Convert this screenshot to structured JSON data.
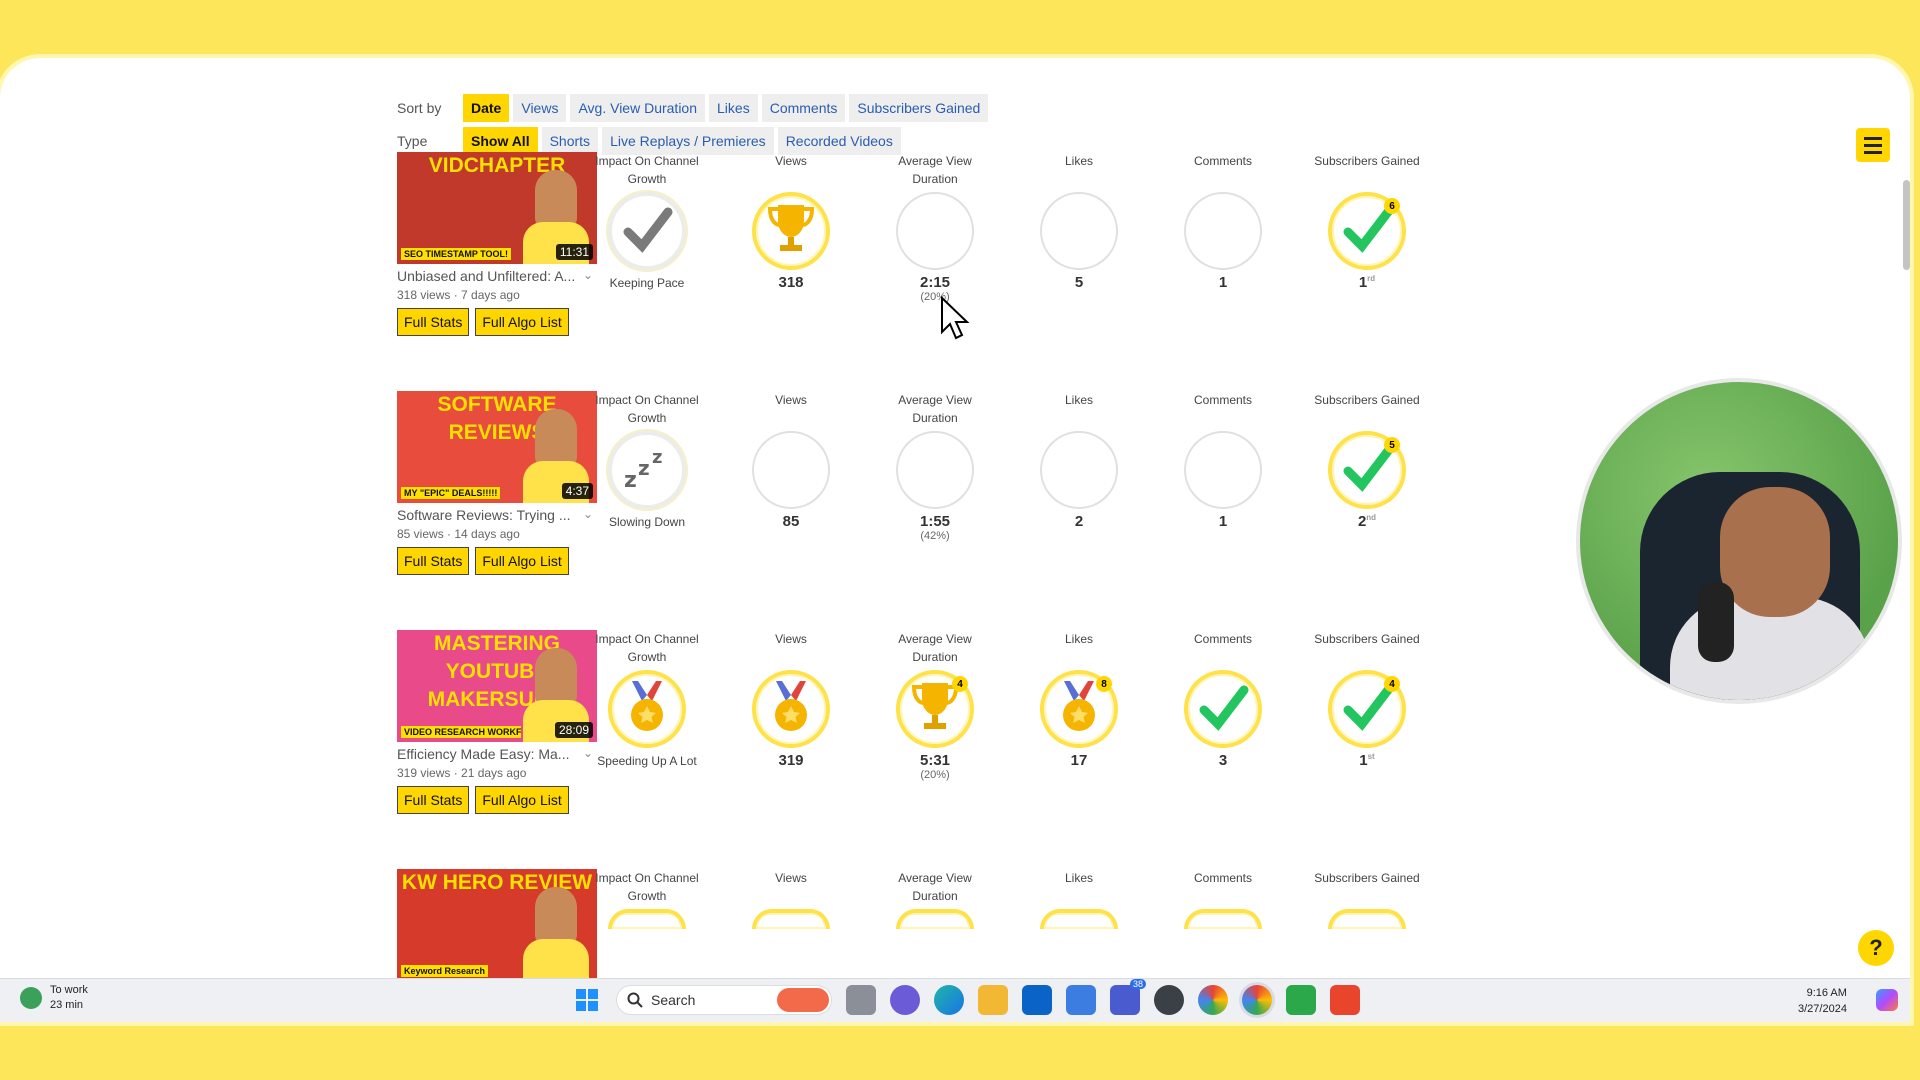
{
  "filters": {
    "sort_label": "Sort by",
    "sort_options": [
      "Date",
      "Views",
      "Avg. View Duration",
      "Likes",
      "Comments",
      "Subscribers Gained"
    ],
    "sort_active": "Date",
    "type_label": "Type",
    "type_options": [
      "Show All",
      "Shorts",
      "Live Replays / Premieres",
      "Recorded Videos"
    ],
    "type_active": "Show All"
  },
  "metric_labels": {
    "impact": "Impact On Channel Growth",
    "views": "Views",
    "avd": "Average View Duration",
    "likes": "Likes",
    "comments": "Comments",
    "subs": "Subscribers Gained"
  },
  "buttons": {
    "full_stats": "Full Stats",
    "full_algo": "Full Algo List"
  },
  "videos": [
    {
      "thumb_text": "VIDCHAPTER",
      "thumb_sub": "SEO TIMESTAMP TOOL!",
      "thumb_bg": "#c0392b",
      "duration": "11:31",
      "title": "Unbiased and Unfiltered: A...",
      "meta": "318 views · 7 days ago",
      "impact": {
        "status": "Keeping Pace",
        "icon": "check-grey-icon"
      },
      "views": {
        "value": "318",
        "icon": "trophy-icon"
      },
      "avd": {
        "value": "2:15",
        "sub": "(20%)",
        "icon": ""
      },
      "likes": {
        "value": "5",
        "icon": ""
      },
      "comments": {
        "value": "1",
        "icon": ""
      },
      "subs": {
        "value": "1",
        "rank": "rd",
        "icon": "check-green-icon",
        "badge": "6"
      }
    },
    {
      "thumb_text": "SOFTWARE REVIEWS",
      "thumb_sub": "MY \"EPIC\" DEALS!!!!!",
      "thumb_bg": "#e74c3c",
      "duration": "4:37",
      "title": "Software Reviews: Trying ...",
      "meta": "85 views · 14 days ago",
      "impact": {
        "status": "Slowing Down",
        "icon": "sleep-zzz-icon"
      },
      "views": {
        "value": "85",
        "icon": ""
      },
      "avd": {
        "value": "1:55",
        "sub": "(42%)",
        "icon": ""
      },
      "likes": {
        "value": "2",
        "icon": ""
      },
      "comments": {
        "value": "1",
        "icon": ""
      },
      "subs": {
        "value": "2",
        "rank": "nd",
        "icon": "check-green-icon",
        "badge": "5"
      }
    },
    {
      "thumb_text": "MASTERING YOUTUBE MAKERSUITE",
      "thumb_sub": "VIDEO RESEARCH WORKFLOW!",
      "thumb_bg": "#e84a8a",
      "duration": "28:09",
      "title": "Efficiency Made Easy: Ma...",
      "meta": "319 views · 21 days ago",
      "impact": {
        "status": "Speeding Up A Lot",
        "icon": "medal-icon"
      },
      "views": {
        "value": "319",
        "icon": "medal-icon"
      },
      "avd": {
        "value": "5:31",
        "sub": "(20%)",
        "icon": "trophy-icon",
        "badge": "4"
      },
      "likes": {
        "value": "17",
        "icon": "medal-icon",
        "badge": "8"
      },
      "comments": {
        "value": "3",
        "icon": "check-green-icon"
      },
      "subs": {
        "value": "1",
        "rank": "st",
        "icon": "check-green-icon",
        "badge": "4"
      }
    },
    {
      "thumb_text": "KW HERO REVIEW",
      "thumb_sub": "Keyword Research",
      "thumb_bg": "#d63a2a",
      "duration": "",
      "title": "",
      "meta": ""
    }
  ],
  "taskbar": {
    "weather_line1": "To work",
    "weather_line2": "23 min",
    "search_placeholder": "Search",
    "teams_badge": "38",
    "time": "9:16 AM",
    "date": "3/27/2024"
  },
  "help_label": "?",
  "colors": {
    "accent": "#ffd600",
    "link": "#2a5db0",
    "check": "#22c55e"
  }
}
